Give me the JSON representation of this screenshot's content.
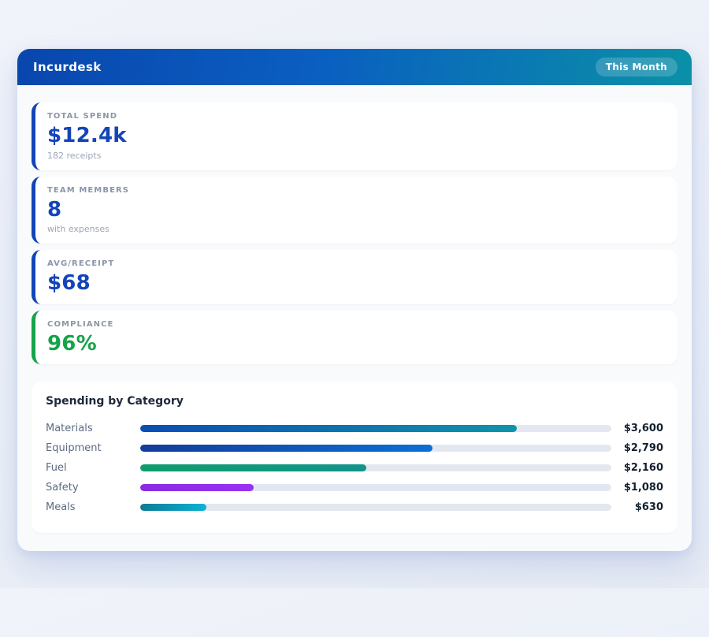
{
  "header": {
    "title": "Incurdesk",
    "badge_label": "This Month",
    "gradient_from": "#0946ae",
    "gradient_to": "#0b90a7"
  },
  "stats": [
    {
      "label": "TOTAL SPEND",
      "value": "$12.4k",
      "sub": "182 receipts",
      "accent": "#1445b8"
    },
    {
      "label": "TEAM MEMBERS",
      "value": "8",
      "sub": "with expenses",
      "accent": "#1445b8"
    },
    {
      "label": "AVG/RECEIPT",
      "value": "$68",
      "sub": "",
      "accent": "#1445b8"
    },
    {
      "label": "COMPLIANCE",
      "value": "96%",
      "sub": "",
      "accent": "#16a34a"
    }
  ],
  "chart_data": {
    "type": "bar",
    "orientation": "horizontal",
    "title": "Spending by Category",
    "categories": [
      "Materials",
      "Equipment",
      "Fuel",
      "Safety",
      "Meals"
    ],
    "values": [
      3600,
      2790,
      2160,
      1080,
      630
    ],
    "value_labels": [
      "$3,600",
      "$2,790",
      "$2,160",
      "$1,080",
      "$630"
    ],
    "scale_max": 4500,
    "track_color": "#e3e8f0",
    "bar_gradients": [
      [
        "#0b4db5",
        "#0e94a9"
      ],
      [
        "#123c9b",
        "#0b6fd4"
      ],
      [
        "#0f9d6b",
        "#12938c"
      ],
      [
        "#8a2be2",
        "#9b30f2"
      ],
      [
        "#0e7a94",
        "#0cb2d6"
      ]
    ],
    "legend": "none",
    "grid": false
  }
}
